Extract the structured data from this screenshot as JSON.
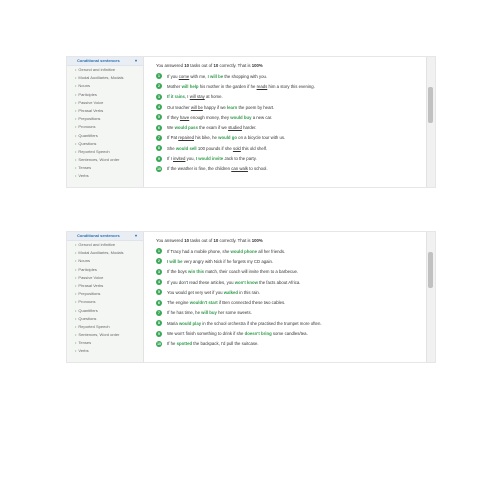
{
  "panels": [
    {
      "sidebar": {
        "title": "Conditional sentences",
        "items": [
          "Gerund and infinitive",
          "Modal Auxiliaries, Modals",
          "Nouns",
          "Participles",
          "Passive Voice",
          "Phrasal Verbs",
          "Prepositions",
          "Pronouns",
          "Quantifiers",
          "Questions",
          "Reported Speech",
          "Sentences, Word order",
          "Tenses",
          "Verbs"
        ]
      },
      "summary": {
        "prefix": "You answered",
        "correct": "10",
        "middle": "tasks out of",
        "total": "10",
        "suffix1": "correctly. That is",
        "percent": "100%"
      },
      "sentences": [
        {
          "n": "1",
          "parts": [
            [
              "If you ",
              ""
            ],
            [
              "come",
              "u"
            ],
            [
              " with me, ",
              ""
            ],
            [
              "I will be",
              "g"
            ],
            [
              " the shopping with you.",
              ""
            ]
          ]
        },
        {
          "n": "2",
          "parts": [
            [
              "Mother ",
              ""
            ],
            [
              "will help",
              "g"
            ],
            [
              " his mother in the garden if he ",
              ""
            ],
            [
              "reads",
              "u"
            ],
            [
              " him a story this evening.",
              ""
            ]
          ]
        },
        {
          "n": "3",
          "parts": [
            [
              "If it rains",
              "g"
            ],
            [
              ", I ",
              ""
            ],
            [
              "will stay",
              "u"
            ],
            [
              " at home.",
              ""
            ]
          ]
        },
        {
          "n": "4",
          "parts": [
            [
              "Our teacher ",
              ""
            ],
            [
              "will be",
              "u"
            ],
            [
              " happy if we ",
              ""
            ],
            [
              "learn",
              "g"
            ],
            [
              " the poem by heart.",
              ""
            ]
          ]
        },
        {
          "n": "5",
          "parts": [
            [
              "If they ",
              ""
            ],
            [
              "have",
              "u"
            ],
            [
              " enough money, they ",
              ""
            ],
            [
              "would buy",
              "g"
            ],
            [
              " a new car.",
              ""
            ]
          ]
        },
        {
          "n": "6",
          "parts": [
            [
              "We ",
              ""
            ],
            [
              "would pass",
              "g"
            ],
            [
              " the exam if we ",
              ""
            ],
            [
              "studied",
              "u"
            ],
            [
              " harder.",
              ""
            ]
          ]
        },
        {
          "n": "7",
          "parts": [
            [
              "If Pat ",
              ""
            ],
            [
              "repaired",
              "u"
            ],
            [
              " his bike, he ",
              ""
            ],
            [
              "would go",
              "g"
            ],
            [
              " on a bicycle tour with us.",
              ""
            ]
          ]
        },
        {
          "n": "8",
          "parts": [
            [
              "She ",
              ""
            ],
            [
              "would sell",
              "g"
            ],
            [
              " 100 pounds if she ",
              ""
            ],
            [
              "sold",
              "u"
            ],
            [
              " this old shelf.",
              ""
            ]
          ]
        },
        {
          "n": "9",
          "parts": [
            [
              "If I ",
              ""
            ],
            [
              "invited",
              "u"
            ],
            [
              " you, ",
              ""
            ],
            [
              "I would invite",
              "g"
            ],
            [
              " Jack to the party.",
              ""
            ]
          ]
        },
        {
          "n": "10",
          "parts": [
            [
              "If the weather is fine, the children ",
              ""
            ],
            [
              "can walk",
              "u"
            ],
            [
              " to school.",
              ""
            ]
          ]
        }
      ]
    },
    {
      "sidebar": {
        "title": "Conditional sentences",
        "items": [
          "Gerund and infinitive",
          "Modal Auxiliaries, Modals",
          "Nouns",
          "Participles",
          "Passive Voice",
          "Phrasal Verbs",
          "Prepositions",
          "Pronouns",
          "Quantifiers",
          "Questions",
          "Reported Speech",
          "Sentences, Word order",
          "Tenses",
          "Verbs"
        ]
      },
      "summary": {
        "prefix": "You answered",
        "correct": "10",
        "middle": "tasks out of",
        "total": "10",
        "suffix1": "correctly. That is",
        "percent": "100%"
      },
      "sentences": [
        {
          "n": "1",
          "parts": [
            [
              "If Tracy had a mobile phone, she ",
              ""
            ],
            [
              "would phone",
              "g"
            ],
            [
              " all her friends.",
              ""
            ]
          ]
        },
        {
          "n": "2",
          "parts": [
            [
              "I will be",
              "g"
            ],
            [
              " very angry with Nick if he forgets my CD again.",
              ""
            ]
          ]
        },
        {
          "n": "3",
          "parts": [
            [
              "If the boys ",
              ""
            ],
            [
              "win this",
              "g"
            ],
            [
              " match, their coach will invite them to a barbecue.",
              ""
            ]
          ]
        },
        {
          "n": "4",
          "parts": [
            [
              "If you don't read these articles, you ",
              ""
            ],
            [
              "won't know",
              "g"
            ],
            [
              " the facts about Africa.",
              ""
            ]
          ]
        },
        {
          "n": "5",
          "parts": [
            [
              "You would get very wet if you ",
              ""
            ],
            [
              "walked",
              "g"
            ],
            [
              " in this rain.",
              ""
            ]
          ]
        },
        {
          "n": "6",
          "parts": [
            [
              "The engine ",
              ""
            ],
            [
              "wouldn't start",
              "g"
            ],
            [
              " if Ben connected these two cables.",
              ""
            ]
          ]
        },
        {
          "n": "7",
          "parts": [
            [
              "If he has time, he ",
              ""
            ],
            [
              "will buy",
              "g"
            ],
            [
              " her some sweets.",
              ""
            ]
          ]
        },
        {
          "n": "8",
          "parts": [
            [
              "Maria ",
              ""
            ],
            [
              "would play",
              "g"
            ],
            [
              " in the school orchestra if she practised the trumpet more often.",
              ""
            ]
          ]
        },
        {
          "n": "9",
          "parts": [
            [
              "We won't finish something to drink if she ",
              ""
            ],
            [
              "doesn't bring",
              "g"
            ],
            [
              " some candles/tea.",
              ""
            ]
          ]
        },
        {
          "n": "10",
          "parts": [
            [
              "If he ",
              ""
            ],
            [
              "spotted",
              "g"
            ],
            [
              " the backpack, I'd pull the suitcase.",
              ""
            ]
          ]
        }
      ]
    }
  ],
  "icons": {
    "sidebar-chevron": "chevron-down-icon",
    "sidebar-bullet": "bullet-icon"
  },
  "colors": {
    "accent_green": "#3aa857",
    "answer_green": "#2e9a4a",
    "link_blue": "#2a6fb0"
  }
}
